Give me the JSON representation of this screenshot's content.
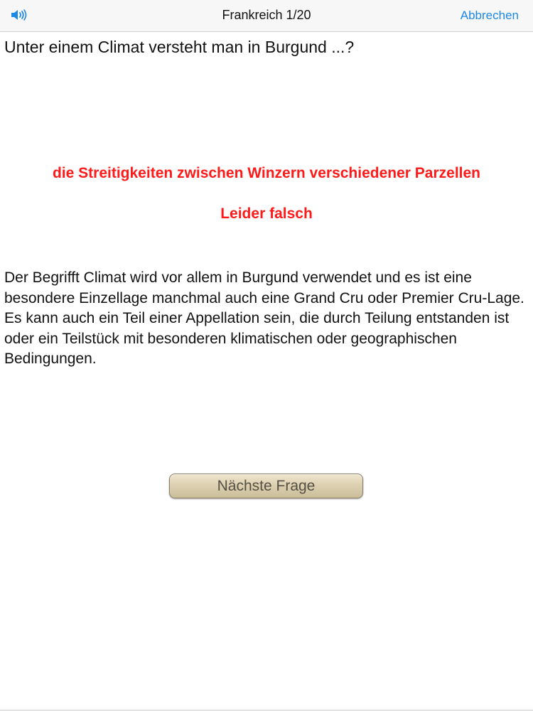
{
  "navbar": {
    "sound_icon": "speaker-volume-icon",
    "title": "Frankreich 1/20",
    "cancel_label": "Abbrechen",
    "accent_color": "#1e88e5"
  },
  "quiz": {
    "question": "Unter einem Climat versteht man in Burgund ...?",
    "selected_answer": "die Streitigkeiten zwischen Winzern verschiedener Parzellen",
    "verdict": "Leider falsch",
    "verdict_color": "#ff1a1a",
    "explanation": "Der Begrifft Climat wird vor allem in Burgund verwendet und es ist eine besondere Einzellage manchmal auch eine Grand Cru oder Premier Cru-Lage. Es kann auch ein Teil einer Appellation sein, die durch Teilung entstanden ist oder ein Teilstück mit besonderen klimatischen oder geographischen Bedingungen.",
    "next_label": "Nächste Frage"
  }
}
